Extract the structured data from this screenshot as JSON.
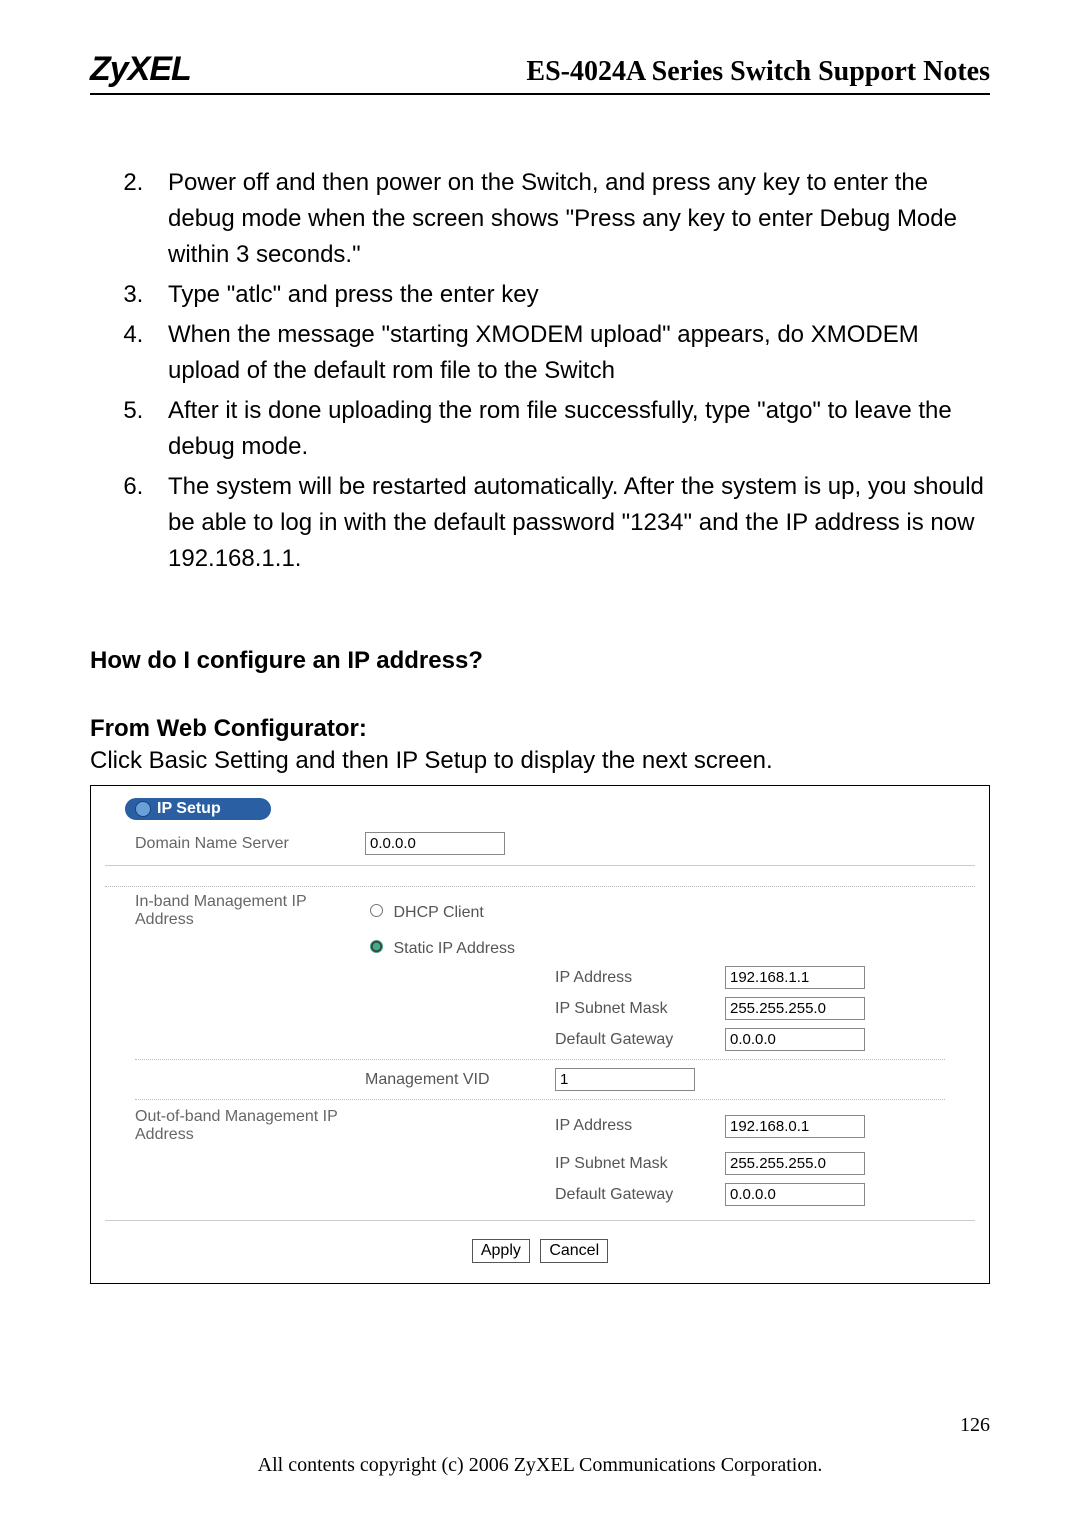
{
  "header": {
    "logo": "ZyXEL",
    "title": "ES-4024A Series Switch Support Notes"
  },
  "list": {
    "start": 2,
    "items": [
      "Power off and then power on the Switch, and press any key to enter the debug mode when the screen shows \"Press any key to enter Debug Mode within 3 seconds.\"",
      "Type \"atlc\" and press the enter key",
      "When the message \"starting XMODEM upload\" appears, do XMODEM upload of the default rom file to the Switch",
      "After it is done uploading the rom file successfully, type \"atgo\" to leave the debug mode.",
      "The system will be restarted automatically. After the system is up, you should be able to log in with the default password \"1234\" and the IP address is now 192.168.1.1."
    ]
  },
  "section_heading": "How do I configure an IP address?",
  "sub_heading": "From Web Configurator:",
  "body_text": "Click Basic Setting and then IP Setup to display the next screen.",
  "panel": {
    "tab": "IP Setup",
    "dns_label": "Domain Name Server",
    "dns_value": "0.0.0.0",
    "inband_label": "In-band Management IP Address",
    "dhcp_label": "DHCP Client",
    "static_label": "Static IP Address",
    "ip_addr_label": "IP Address",
    "subnet_label": "IP Subnet Mask",
    "gateway_label": "Default Gateway",
    "mgmt_vid_label": "Management VID",
    "mgmt_vid_value": "1",
    "inband_ip": "192.168.1.1",
    "inband_mask": "255.255.255.0",
    "inband_gw": "0.0.0.0",
    "oob_label": "Out-of-band Management IP Address",
    "oob_ip": "192.168.0.1",
    "oob_mask": "255.255.255.0",
    "oob_gw": "0.0.0.0",
    "apply": "Apply",
    "cancel": "Cancel"
  },
  "page_num": "126",
  "footer": "All contents copyright (c) 2006 ZyXEL Communications Corporation."
}
